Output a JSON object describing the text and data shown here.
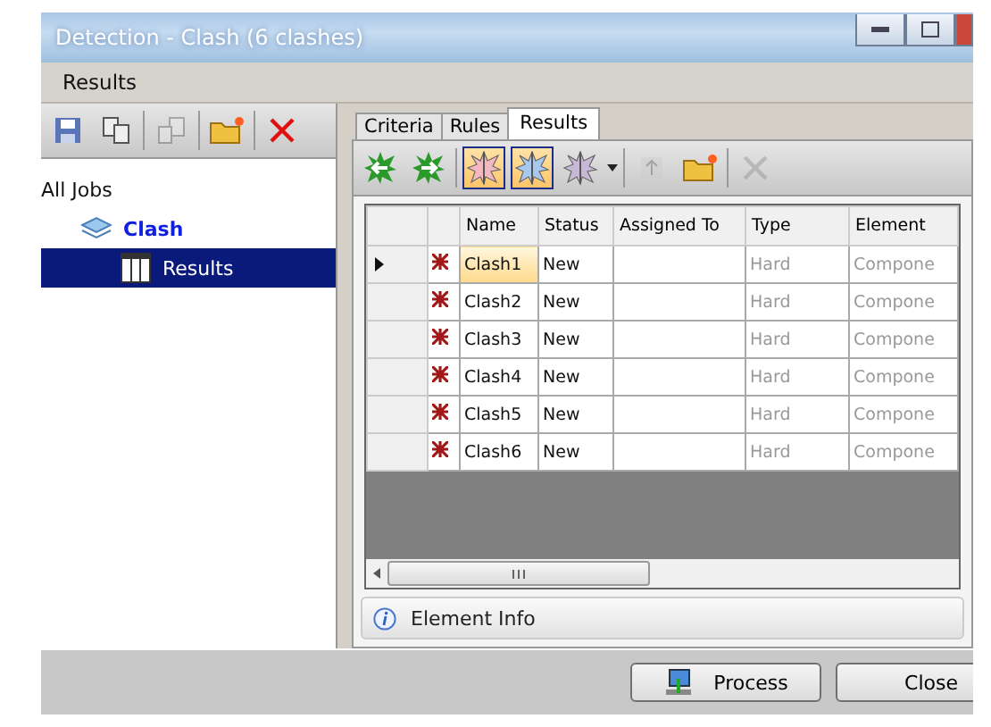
{
  "window": {
    "title": "Detection - Clash (6 clashes)"
  },
  "menu": [
    "Results"
  ],
  "left_toolbar": [
    {
      "kind": "save",
      "disabled": false
    },
    {
      "kind": "copy",
      "disabled": false
    },
    {
      "kind": "paste",
      "disabled": true
    },
    {
      "kind": "folder",
      "disabled": false
    },
    {
      "kind": "delete",
      "disabled": false
    }
  ],
  "tree": [
    {
      "label": "All Jobs",
      "selected": false,
      "children": [
        {
          "label": "Clash",
          "selected": false,
          "children": [
            {
              "label": "Results",
              "selected": true
            }
          ]
        }
      ]
    }
  ],
  "tabs": [
    {
      "label": "Criteria",
      "selected": false
    },
    {
      "label": "Rules",
      "selected": false
    },
    {
      "label": "Results",
      "selected": true
    }
  ],
  "right_toolbar": [
    {
      "kind": "prev",
      "selected": false,
      "disabled": false
    },
    {
      "kind": "next",
      "selected": false,
      "disabled": false
    },
    {
      "kind": "left",
      "selected": true,
      "disabled": false
    },
    {
      "kind": "right",
      "selected": true,
      "disabled": false
    },
    {
      "kind": "both",
      "selected": false,
      "disabled": false
    },
    {
      "kind": "up",
      "selected": false,
      "disabled": true
    },
    {
      "kind": "folder",
      "selected": false,
      "disabled": false
    },
    {
      "kind": "delete",
      "selected": false,
      "disabled": true
    }
  ],
  "table": {
    "columns": [
      "Name",
      "Status",
      "Assigned To",
      "Type",
      "Element"
    ],
    "rows": [
      {
        "selected": true,
        "cells": [
          "Clash1",
          "New",
          "",
          "Hard",
          "Compone"
        ]
      },
      {
        "selected": false,
        "cells": [
          "Clash2",
          "New",
          "",
          "Hard",
          "Compone"
        ]
      },
      {
        "selected": false,
        "cells": [
          "Clash3",
          "New",
          "",
          "Hard",
          "Compone"
        ]
      },
      {
        "selected": false,
        "cells": [
          "Clash4",
          "New",
          "",
          "Hard",
          "Compone"
        ]
      },
      {
        "selected": false,
        "cells": [
          "Clash5",
          "New",
          "",
          "Hard",
          "Compone"
        ]
      },
      {
        "selected": false,
        "cells": [
          "Clash6",
          "New",
          "",
          "Hard",
          "Compone"
        ]
      }
    ]
  },
  "info_bar": {
    "label": "Element Info"
  },
  "buttons": [
    {
      "kind": "process",
      "label": "Process"
    },
    {
      "kind": "plain",
      "label": "Close"
    }
  ]
}
